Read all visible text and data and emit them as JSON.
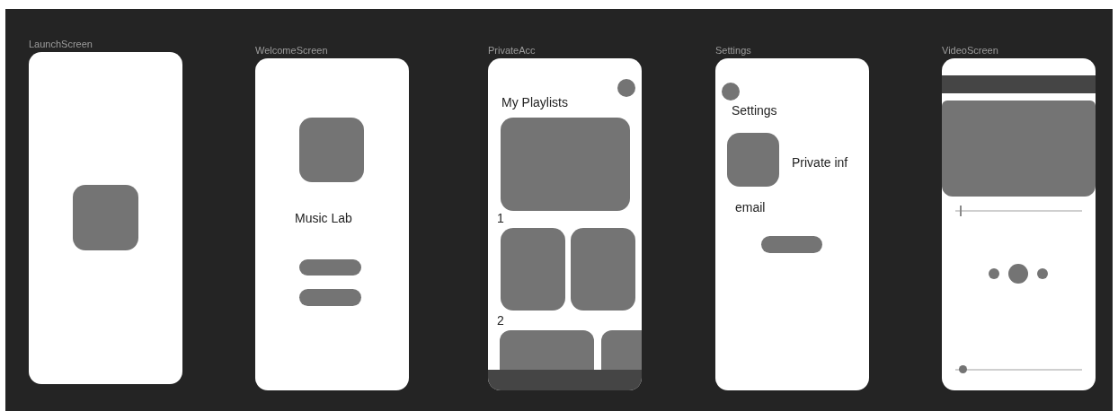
{
  "frames": [
    {
      "kind": "launch",
      "title": "LaunchScreen"
    },
    {
      "kind": "welcome",
      "title": "WelcomeScreen",
      "app_name": "Music Lab"
    },
    {
      "kind": "playlists",
      "title": "PrivateAcc",
      "heading": "My Playlists",
      "sections": [
        "1",
        "2"
      ]
    },
    {
      "kind": "settings",
      "title": "Settings",
      "heading": "Settings",
      "info_label": "Private inf",
      "email_label": "email"
    },
    {
      "kind": "video",
      "title": "VideoScreen",
      "sliders": [
        {
          "kind": "tick",
          "level": 0.04
        },
        {
          "kind": "dot",
          "level": 0.06
        }
      ]
    }
  ]
}
